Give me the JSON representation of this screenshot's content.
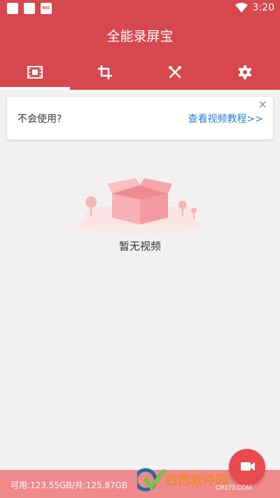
{
  "status_bar": {
    "time": "3:20",
    "badge": "REC"
  },
  "app": {
    "title": "全能录屏宝"
  },
  "tabs": [
    {
      "icon": "video-icon",
      "active": true
    },
    {
      "icon": "crop-icon",
      "active": false
    },
    {
      "icon": "tools-icon",
      "active": false
    },
    {
      "icon": "gear-icon",
      "active": false
    }
  ],
  "help_card": {
    "question": "不会使用?",
    "link": "查看视频教程>>",
    "close": "×"
  },
  "empty_state": {
    "text": "暂无视频"
  },
  "footer": {
    "storage": "可用:123.55GB/共:125.87GB"
  },
  "watermark": {
    "brand": "西西软件园",
    "domain": "CR173.COM"
  },
  "colors": {
    "primary": "#d6474e",
    "footer": "#ef8a8c",
    "link": "#2a7fd0",
    "background": "#f2f0f1"
  }
}
